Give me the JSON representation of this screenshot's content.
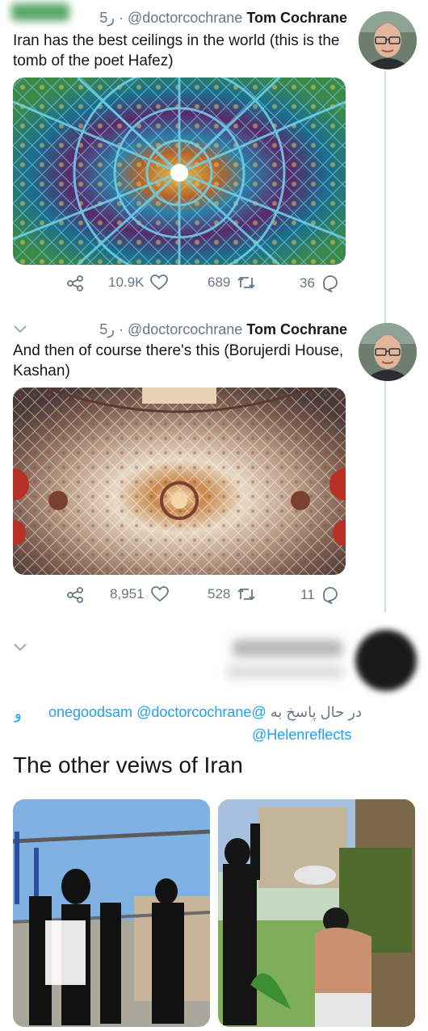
{
  "tweets": [
    {
      "time": "5ر",
      "handle": "@doctorcochrane",
      "name": "Tom Cochrane",
      "text": "Iran has the best ceilings in the world (this is the tomb of the poet Hafez)",
      "image": "hafez-tomb-ceiling",
      "share_icon": "share-icon",
      "likes": "10.9K",
      "retweets": "689",
      "replies": "36"
    },
    {
      "time": "5ر",
      "handle": "@doctorcochrane",
      "name": "Tom Cochrane",
      "text": "And then of course there's this (Borujerdi House, Kashan)",
      "image": "borujerdi-house-ceiling",
      "share_icon": "share-icon",
      "likes": "8,951",
      "retweets": "528",
      "replies": "11"
    }
  ],
  "reply_tweet": {
    "replying_prefix": "در حال پاسخ به",
    "replying_to": [
      "@onegoodsam",
      "@doctorcochrane"
    ],
    "conjunction": "و",
    "replying_to_last": "@Helenreflects",
    "text": "The other veiws of Iran",
    "images": [
      "public-flogging-scene-1",
      "public-flogging-scene-2"
    ]
  },
  "colors": {
    "accent": "#1da1f2",
    "muted": "#657786",
    "thread_line": "#c4dfef",
    "text": "#14171a"
  }
}
